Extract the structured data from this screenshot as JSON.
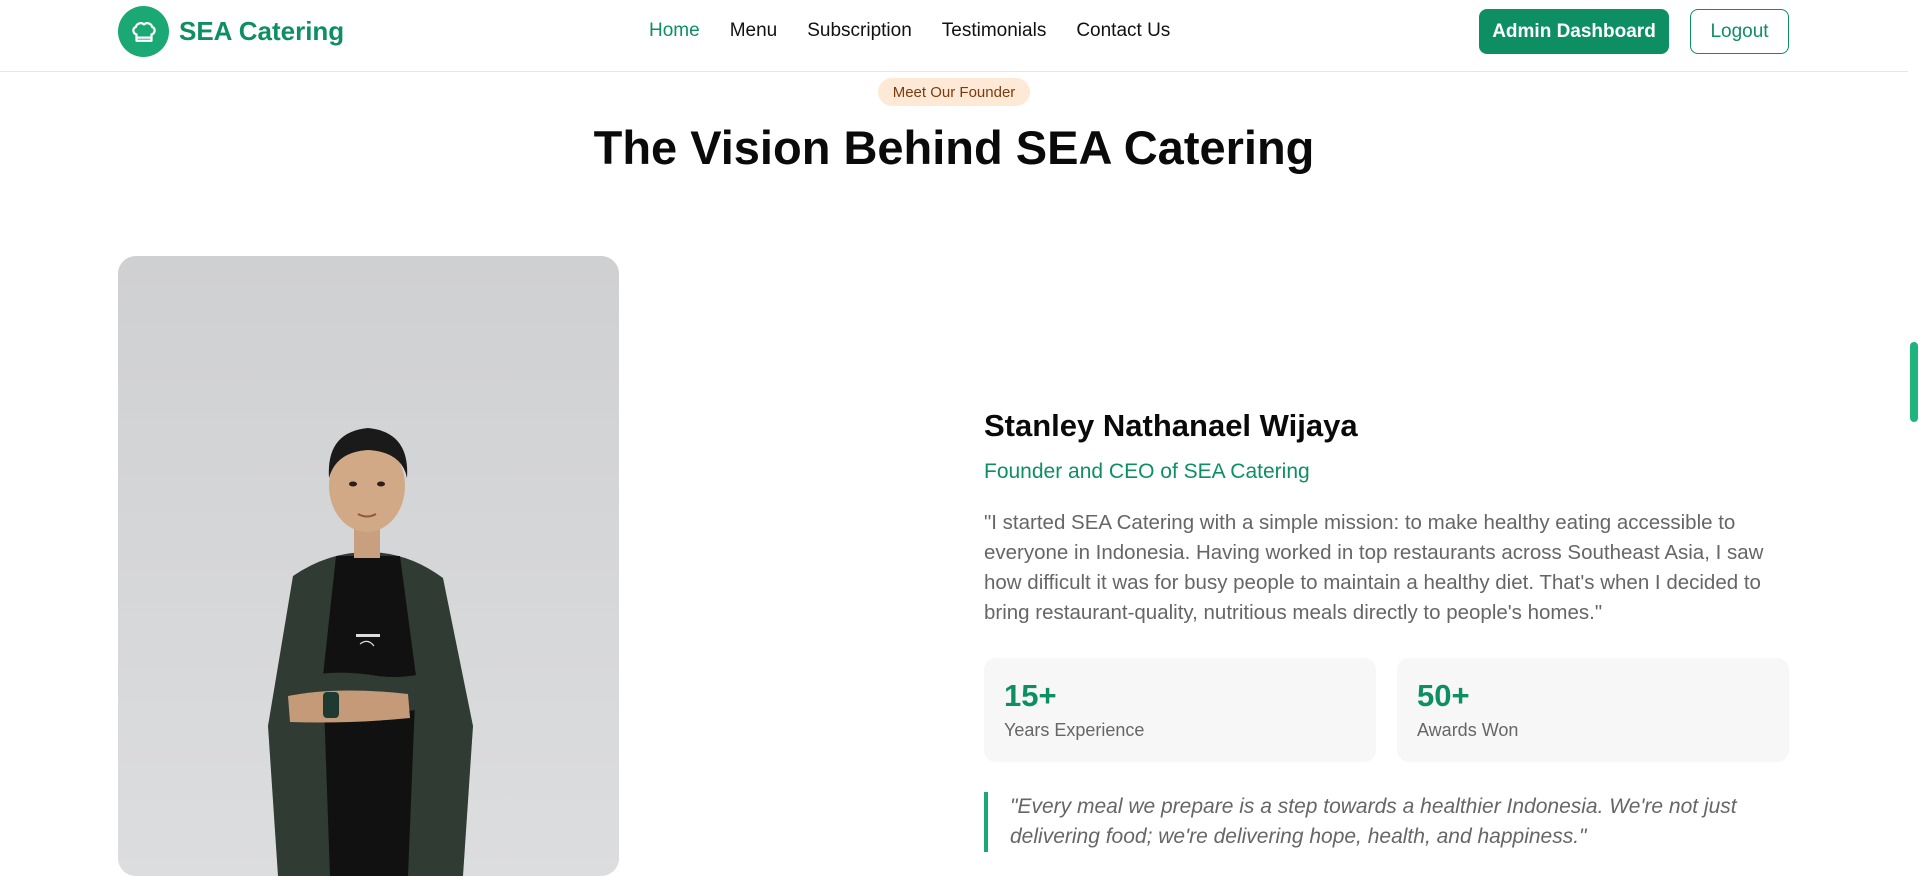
{
  "nav": {
    "brand": "SEA Catering",
    "brand_icon": "chef-hat-icon",
    "links": [
      "Home",
      "Menu",
      "Subscription",
      "Testimonials",
      "Contact Us"
    ],
    "active_link": "Home",
    "admin_button": "Admin Dashboard",
    "logout_button": "Logout"
  },
  "founder_section": {
    "badge": "Meet Our Founder",
    "title": "The Vision Behind SEA Catering",
    "name": "Stanley Nathanael Wijaya",
    "role": "Founder and CEO of SEA Catering",
    "bio": "\"I started SEA Catering with a simple mission: to make healthy eating accessible to everyone in Indonesia. Having worked in top restaurants across Southeast Asia, I saw how difficult it was for busy people to maintain a healthy diet. That's when I decided to bring restaurant-quality, nutritious meals directly to people's homes.\"",
    "stats": [
      {
        "value": "15+",
        "label": "Years Experience"
      },
      {
        "value": "50+",
        "label": "Awards Won"
      }
    ],
    "quote": "\"Every meal we prepare is a step towards a healthier Indonesia. We're not just delivering food; we're delivering hope, health, and happiness.\""
  },
  "colors": {
    "primary": "#0e8f63",
    "accent": "#1aa874",
    "badge_bg": "#fde9d6",
    "badge_text": "#7c3a10",
    "muted_text": "#666666",
    "card_bg": "#f7f7f7"
  }
}
